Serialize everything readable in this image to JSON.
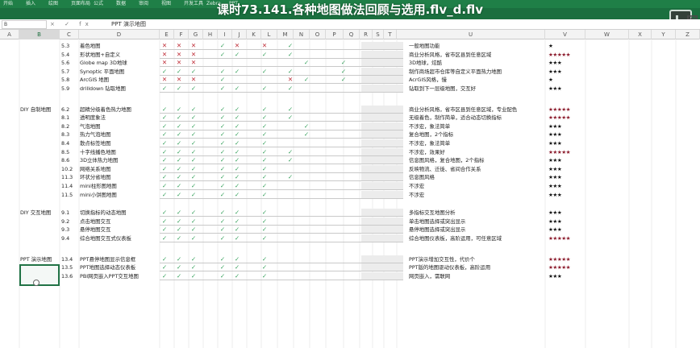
{
  "window": {
    "title": "课时73.141.各种地图做法回顾与选用.flv_d.flv",
    "logo_text": "网"
  },
  "ribbon_tabs": [
    "开始",
    "插入",
    "绘图",
    "页面布局",
    "公式",
    "数据",
    "审阅",
    "视图",
    "开发工具",
    "Zebra",
    "PPT"
  ],
  "formula_bar": {
    "name_box": "B",
    "icons": "× ✓ fx",
    "value": "PPT 演示地图"
  },
  "columns": [
    "A",
    "B",
    "C",
    "D",
    "E",
    "F",
    "G",
    "H",
    "I",
    "J",
    "K",
    "L",
    "M",
    "N",
    "O",
    "P",
    "Q",
    "R",
    "S",
    "T",
    "U",
    "V",
    "W",
    "X",
    "Y",
    "Z"
  ],
  "selected_column": "B",
  "rows": [
    {
      "category": "",
      "num": "5.3",
      "name": "着色地图",
      "marks": [
        "x",
        "x",
        "x",
        "v",
        "x",
        "",
        "x",
        "",
        "v",
        "",
        "",
        "",
        ""
      ],
      "note": "一般地图功能",
      "stars": "★",
      "star_color": "black"
    },
    {
      "category": "",
      "num": "5.4",
      "name": "形状地图+自定义",
      "marks": [
        "x",
        "x",
        "x",
        "v",
        "v",
        "",
        "v",
        "",
        "v",
        "",
        "",
        "",
        ""
      ],
      "note": "商业分析风格，省市区县到任意区域",
      "stars": "★★★★★",
      "star_color": "red"
    },
    {
      "category": "",
      "num": "5.6",
      "name": "Globe map 3D地球",
      "marks": [
        "x",
        "x",
        "x",
        "",
        "",
        "",
        "",
        "",
        "",
        "v",
        "",
        "v",
        ""
      ],
      "note": "3D地球，炫酷",
      "stars": "★★★",
      "star_color": "black"
    },
    {
      "category": "",
      "num": "5.7",
      "name": "Synoptic 平面地图",
      "marks": [
        "v",
        "v",
        "v",
        "v",
        "v",
        "",
        "v",
        "",
        "v",
        "",
        "",
        "v",
        ""
      ],
      "note": "制作商场超市仓库等自定义平面热力地图",
      "stars": "★★★",
      "star_color": "black"
    },
    {
      "category": "",
      "num": "5.8",
      "name": "ArcGIS 地图",
      "marks": [
        "x",
        "x",
        "x",
        "v",
        "",
        "",
        "",
        "",
        "x",
        "v",
        "",
        "v",
        ""
      ],
      "note": "AcrGIS风格，慢",
      "stars": "★",
      "star_color": "black"
    },
    {
      "category": "",
      "num": "5.9",
      "name": "drilldown 钻取地图",
      "marks": [
        "v",
        "v",
        "v",
        "v",
        "v",
        "",
        "v",
        "",
        "v",
        "",
        "",
        "",
        ""
      ],
      "note": "钻取到下一层级地图，交互好",
      "stars": "★★★",
      "star_color": "black"
    },
    {
      "category": "DIY 自制地图",
      "num": "6.2",
      "name": "超精分级着色热力地图",
      "marks": [
        "v",
        "v",
        "v",
        "v",
        "v",
        "",
        "v",
        "",
        "v",
        "",
        "",
        "",
        ""
      ],
      "note": "商业分析风格，省市区县到任意区域，专业配色",
      "stars": "★★★★★",
      "star_color": "red"
    },
    {
      "category": "",
      "num": "8.1",
      "name": "透明度象法",
      "marks": [
        "v",
        "v",
        "v",
        "v",
        "v",
        "",
        "v",
        "",
        "v",
        "",
        "",
        "",
        ""
      ],
      "note": "无级着色，制作简单，适合动态切换指标",
      "stars": "★★★★★",
      "star_color": "red"
    },
    {
      "category": "",
      "num": "8.2",
      "name": "气泡地图",
      "marks": [
        "v",
        "v",
        "v",
        "v",
        "v",
        "",
        "v",
        "",
        "",
        "v",
        "",
        "",
        ""
      ],
      "note": "不涉宏，象法简单",
      "stars": "★★★",
      "star_color": "black"
    },
    {
      "category": "",
      "num": "8.3",
      "name": "热力气泡地图",
      "marks": [
        "v",
        "v",
        "v",
        "v",
        "v",
        "",
        "v",
        "",
        "",
        "v",
        "",
        "",
        ""
      ],
      "note": "复合地图，2个指标",
      "stars": "★★★",
      "star_color": "black"
    },
    {
      "category": "",
      "num": "8.4",
      "name": "散点标签地图",
      "marks": [
        "v",
        "v",
        "v",
        "v",
        "v",
        "",
        "v",
        "",
        "",
        "",
        "",
        "",
        ""
      ],
      "note": "不涉宏，象法简单",
      "stars": "★★★",
      "star_color": "black"
    },
    {
      "category": "",
      "num": "8.5",
      "name": "十字线播色地图",
      "marks": [
        "v",
        "v",
        "v",
        "v",
        "v",
        "",
        "v",
        "",
        "v",
        "",
        "",
        "",
        ""
      ],
      "note": "不涉宏，效果好",
      "stars": "★★★★★",
      "star_color": "red"
    },
    {
      "category": "",
      "num": "8.6",
      "name": "3D立体热力地图",
      "marks": [
        "v",
        "v",
        "v",
        "v",
        "v",
        "",
        "v",
        "",
        "v",
        "",
        "",
        "",
        ""
      ],
      "note": "信息图风格，复合地图，2个指标",
      "stars": "★★★",
      "star_color": "black"
    },
    {
      "category": "",
      "num": "10.2",
      "name": "网络关系地图",
      "marks": [
        "v",
        "v",
        "v",
        "v",
        "v",
        "",
        "v",
        "",
        "",
        "",
        "",
        "",
        ""
      ],
      "note": "反映物流、迁徙、省间合作关系",
      "stars": "★★★",
      "star_color": "black"
    },
    {
      "category": "",
      "num": "11.3",
      "name": "环状分省地图",
      "marks": [
        "v",
        "v",
        "v",
        "v",
        "v",
        "",
        "v",
        "",
        "v",
        "",
        "",
        "",
        ""
      ],
      "note": "信息图风格",
      "stars": "★★★",
      "star_color": "black"
    },
    {
      "category": "",
      "num": "11.4",
      "name": "mini柱形图地图",
      "marks": [
        "v",
        "v",
        "v",
        "v",
        "v",
        "",
        "v",
        "",
        "",
        "",
        "",
        "",
        ""
      ],
      "note": "不涉宏",
      "stars": "★★★",
      "star_color": "black"
    },
    {
      "category": "",
      "num": "11.5",
      "name": "mini小饼图地图",
      "marks": [
        "v",
        "v",
        "v",
        "v",
        "v",
        "",
        "v",
        "",
        "",
        "",
        "",
        "",
        ""
      ],
      "note": "不涉宏",
      "stars": "★★★",
      "star_color": "black"
    },
    {
      "category": "DIY 交互地图",
      "num": "9.1",
      "name": "切换指标的动态地图",
      "marks": [
        "v",
        "v",
        "v",
        "v",
        "v",
        "",
        "v",
        "",
        "",
        "",
        "",
        "",
        ""
      ],
      "note": "多指标交互地图分析",
      "stars": "★★★",
      "star_color": "black"
    },
    {
      "category": "",
      "num": "9.2",
      "name": "点击地图交互",
      "marks": [
        "v",
        "v",
        "v",
        "v",
        "v",
        "",
        "v",
        "",
        "",
        "",
        "",
        "",
        ""
      ],
      "note": "单击地图选择或突出显示",
      "stars": "★★★",
      "star_color": "black"
    },
    {
      "category": "",
      "num": "9.3",
      "name": "悬停地图交互",
      "marks": [
        "v",
        "v",
        "v",
        "v",
        "v",
        "",
        "v",
        "",
        "",
        "",
        "",
        "",
        ""
      ],
      "note": "悬停地图选择或突出显示",
      "stars": "★★★",
      "star_color": "black"
    },
    {
      "category": "",
      "num": "9.4",
      "name": "综合地图交互式仪表板",
      "marks": [
        "v",
        "v",
        "v",
        "v",
        "v",
        "",
        "v",
        "",
        "",
        "",
        "",
        "",
        ""
      ],
      "note": "综合地图仪表板，高阶运用，可任意区域",
      "stars": "★★★★★",
      "star_color": "red"
    },
    {
      "category": "PPT 演示地图",
      "num": "13.4",
      "name": "PPT悬停地图显示信息框",
      "marks": [
        "v",
        "v",
        "v",
        "v",
        "v",
        "",
        "v",
        "",
        "",
        "",
        "",
        "",
        ""
      ],
      "note": "PPT演示增加交互性，代价个",
      "stars": "★★★★★",
      "star_color": "red"
    },
    {
      "category": "",
      "num": "13.5",
      "name": "PPT地图选择动态仪表板",
      "marks": [
        "v",
        "v",
        "v",
        "v",
        "v",
        "",
        "v",
        "",
        "",
        "",
        "",
        "",
        ""
      ],
      "note": "PPT版的地图驱动仪表板，高阶运用",
      "stars": "★★★★★",
      "star_color": "red"
    },
    {
      "category": "",
      "num": "13.6",
      "name": "PBI网页嵌入PPT交互地图",
      "marks": [
        "v",
        "v",
        "v",
        "v",
        "v",
        "",
        "v",
        "",
        "",
        "",
        "",
        "",
        ""
      ],
      "note": "网页嵌入，需联网",
      "stars": "★★★",
      "star_color": "black"
    }
  ],
  "colors": {
    "check": "#3aa35f",
    "cross": "#c0303a",
    "star_red": "#8b1a2b",
    "ribbon": "#1f7f47",
    "selection": "#217346"
  }
}
